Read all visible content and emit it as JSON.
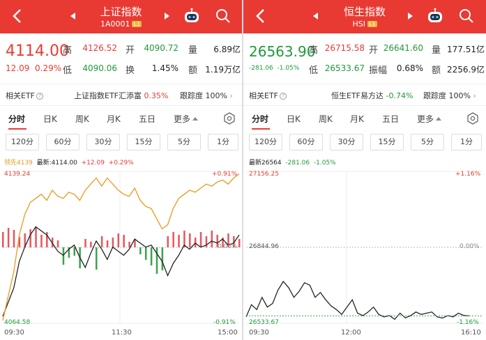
{
  "left": {
    "header": {
      "title": "上证指数",
      "code": "1A0001",
      "level": "L1"
    },
    "quote": {
      "price": "4114.00",
      "change": "12.09",
      "change_pct": "0.29%",
      "high_label": "高",
      "high": "4126.52",
      "open_label": "开",
      "open": "4090.72",
      "vol_label": "量",
      "vol": "6.89亿",
      "low_label": "低",
      "low": "4090.06",
      "turnover_label": "换",
      "turnover": "1.45%",
      "amount_label": "额",
      "amount": "1.19万亿"
    },
    "etf": {
      "label": "相关ETF",
      "name": "上证指数ETF汇添富",
      "pct": "0.35%",
      "track_label": "跟踪度",
      "track": "100%"
    },
    "tabs": [
      "分时",
      "日K",
      "周K",
      "月K",
      "五日",
      "更多"
    ],
    "periods": [
      "120分",
      "60分",
      "30分",
      "15分",
      "5分",
      "1分"
    ],
    "legend": {
      "lead": "领先4139",
      "latest": "最新:4114.00",
      "chg": "+12.09",
      "pct": "+0.29%"
    },
    "axis": {
      "top": "4139.24",
      "bottom": "4064.58",
      "top_pct": "+0.91%",
      "mid_pct": "0.00%",
      "bottom_pct": "-0.91%"
    },
    "times": [
      "09:30",
      "11:30",
      "15:00"
    ],
    "chart_data": {
      "type": "line",
      "ylim": [
        4064.58,
        4139.24
      ],
      "series": [
        {
          "values": [
            4068,
            4075,
            4082,
            4095,
            4102,
            4108,
            4112,
            4110,
            4108,
            4104,
            4100,
            4098,
            4101,
            4103,
            4097,
            4092,
            4099,
            4105,
            4101,
            4096,
            4102,
            4100,
            4098,
            4101,
            4106,
            4104,
            4102,
            4103,
            4099,
            4095,
            4088,
            4094,
            4098,
            4103,
            4101,
            4104,
            4102,
            4103,
            4105,
            4104,
            4106,
            4103,
            4104,
            4108
          ]
        },
        {
          "values": [
            4066,
            4078,
            4090,
            4108,
            4118,
            4124,
            4126,
            4128,
            4125,
            4130,
            4127,
            4126,
            4129,
            4128,
            4125,
            4130,
            4133,
            4136,
            4132,
            4136,
            4133,
            4130,
            4128,
            4127,
            4131,
            4125,
            4122,
            4121,
            4116,
            4111,
            4113,
            4121,
            4126,
            4128,
            4130,
            4129,
            4131,
            4133,
            4132,
            4134,
            4135,
            4133,
            4136,
            4138
          ]
        }
      ],
      "volume": [
        22,
        28,
        25,
        15,
        20,
        26,
        30,
        18,
        22,
        14,
        10,
        -25,
        -15,
        -12,
        -30,
        12,
        8,
        -32,
        16,
        10,
        14,
        20,
        18,
        8,
        12,
        -10,
        -18,
        -26,
        -38,
        -33,
        16,
        22,
        18,
        24,
        20,
        14,
        22,
        16,
        24,
        18,
        14,
        20,
        16,
        12
      ]
    }
  },
  "right": {
    "header": {
      "title": "恒生指数",
      "code": "HSI",
      "level": "L1"
    },
    "quote": {
      "price": "26563.90",
      "change": "-281.06",
      "change_pct": "-1.05%",
      "high_label": "高",
      "high": "26715.58",
      "open_label": "开",
      "open": "26641.60",
      "vol_label": "量",
      "vol": "177.51亿",
      "low_label": "低",
      "low": "26533.67",
      "amp_label": "振幅",
      "amp": "0.68%",
      "amount_label": "额",
      "amount": "2256.9亿"
    },
    "etf": {
      "label": "相关ETF",
      "name": "恒生ETF易方达",
      "pct": "-0.74%",
      "track_label": "跟踪度",
      "track": "100%"
    },
    "tabs": [
      "分时",
      "日K",
      "周K",
      "月K",
      "五日",
      "更多"
    ],
    "periods": [
      "120分",
      "60分",
      "30分",
      "15分",
      "5分",
      "1分"
    ],
    "legend": {
      "latest": "最新26564",
      "chg": "-281.06",
      "pct": "-1.05%"
    },
    "axis": {
      "top": "27156.25",
      "mid": "26844.96",
      "bottom": "26533.67",
      "top_pct": "+1.16%",
      "mid_pct": "0.00%",
      "bottom_pct": "-1.16%"
    },
    "times": [
      "09:30",
      "12:00",
      "16:10"
    ],
    "chart_data": {
      "type": "line",
      "ylim": [
        26533.67,
        27156.25
      ],
      "series": [
        {
          "values": [
            26560,
            26610,
            26590,
            26640,
            26600,
            26615,
            26670,
            26705,
            26680,
            26640,
            26665,
            26700,
            26690,
            26640,
            26660,
            26630,
            26605,
            26590,
            26570,
            26600,
            26630,
            26575,
            26565,
            26580,
            26600,
            26570,
            26560,
            26565,
            26550,
            26575,
            26556,
            26565,
            26580,
            26570,
            26575,
            26580,
            26560,
            26555,
            26565,
            26560,
            26575,
            26566,
            26564
          ]
        }
      ]
    }
  }
}
